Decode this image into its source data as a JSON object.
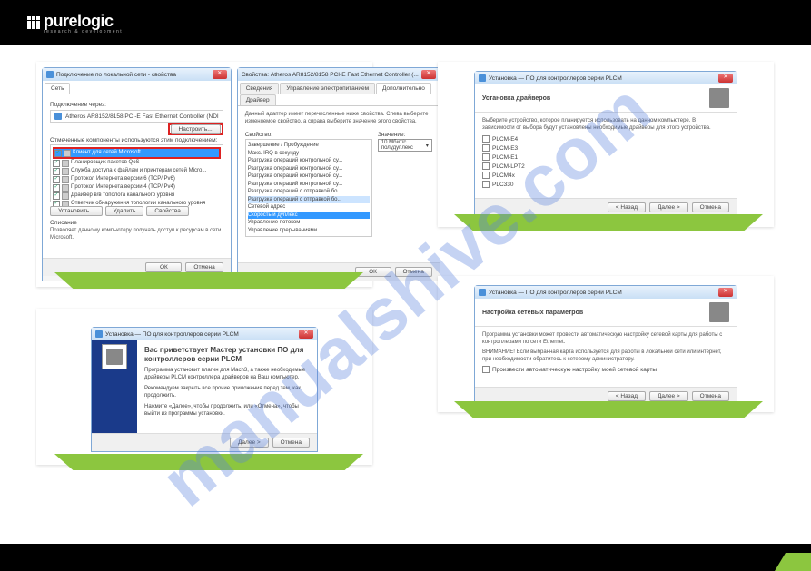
{
  "logo": {
    "name": "purelogic",
    "tagline": "research & development"
  },
  "watermark": "manualshive.com",
  "panelA": {
    "win1": {
      "title": "Подключение по локальной сети - свойства",
      "tabs": [
        "Сеть"
      ],
      "adapter_label": "Подключение через:",
      "adapter_name": "Atheros AR8152/8158 PCI-E Fast Ethernet Controller (NDI",
      "configure_btn": "Настроить...",
      "components_label": "Отмеченные компоненты используются этим подключением:",
      "components": [
        "Клиент для сетей Microsoft",
        "Планировщик пакетов QoS",
        "Служба доступа к файлам и принтерам сетей Micro...",
        "Протокол Интернета версии 6 (TCP/IPv6)",
        "Протокол Интернета версии 4 (TCP/IPv4)",
        "Драйвер в/в тополога канального уровня",
        "Ответчик обнаружения топологии канального уровня"
      ],
      "btns": {
        "install": "Установить...",
        "uninstall": "Удалить",
        "props": "Свойства"
      },
      "desc_label": "Описание",
      "desc_text": "Позволяет данному компьютеру получать доступ к ресурсам в сети Microsoft.",
      "ok": "ОК",
      "cancel": "Отмена"
    },
    "win2": {
      "title": "Свойства: Atheros AR8152/8158 PCI-E Fast Ethernet Controller (...",
      "tabs": [
        "Сведения",
        "Управление электропитанием",
        "Дополнительно",
        "Драйвер"
      ],
      "intro": "Данный адаптер имеет перечисленные ниже свойства. Слева выберите изменяемое свойство, а справа выберите значение этого свойства.",
      "prop_label": "Свойство:",
      "value_label": "Значение:",
      "props": [
        "Завершение / Пробуждение",
        "Макс. IRQ в секунду",
        "Разгрузка операций контрольной су...",
        "Разгрузка операций контрольной су...",
        "Разгрузка операций контрольной су...",
        "Разгрузка операций контрольной су...",
        "Разгрузка операций с отправкой бо...",
        "Разгрузка операций с отправкой бо...",
        "Сетевой адрес",
        "Скорость и дуплекс",
        "Управление потоком",
        "Управление прерываниями"
      ],
      "value_selected": "10 Мбит/с полудуплекс",
      "ok": "ОК",
      "cancel": "Отмена"
    }
  },
  "panelB": {
    "title": "Установка — ПО для контроллеров серии PLCM",
    "heading": "Вас приветствует Мастер установки ПО для контроллеров серии PLCM",
    "p1": "Программа установит плагин для Mach3, а также необходимые драйверы PLCM контроллера драйверов на Ваш компьютер.",
    "p2": "Рекомендуем закрыть все прочие приложения перед тем, как продолжить.",
    "p3": "Нажмите «Далее», чтобы продолжить, или «Отмена», чтобы выйти из программы установки.",
    "next": "Далее >",
    "cancel": "Отмена"
  },
  "panelC": {
    "title": "Установка — ПО для контроллеров серии PLCM",
    "heading": "Установка драйверов",
    "intro": "Выберите устройство, которое планируется использовать на данном компьютере. В зависимости от выбора будут установлены необходимые драйверы для этого устройства.",
    "options": [
      "PLCM-E4",
      "PLCM-E3",
      "PLCM-E1",
      "PLCM-LPT2",
      "PLCM4x",
      "PLC330"
    ],
    "back": "< Назад",
    "next": "Далее >",
    "cancel": "Отмена"
  },
  "panelD": {
    "title": "Установка — ПО для контроллеров серии PLCM",
    "heading": "Настройка сетевых параметров",
    "p1": "Программа установки может провести автоматическую настройку сетевой карты для работы с контроллерами по сети Ethernet.",
    "p2": "ВНИМАНИЕ! Если выбранная карта используется для работы в локальной сети или интернет, при необходимости обратитесь к сетевому администратору.",
    "checkbox": "Произвести автоматическую настройку моей сетевой карты",
    "back": "< Назад",
    "next": "Далее >",
    "cancel": "Отмена"
  }
}
